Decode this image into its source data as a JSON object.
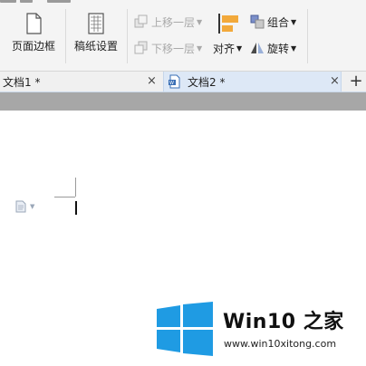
{
  "ribbon": {
    "page_border_label": "页面边框",
    "paper_settings_label": "稿纸设置",
    "bring_forward_label": "上移一层",
    "send_backward_label": "下移一层",
    "align_label": "对齐",
    "group_label": "组合",
    "rotate_label": "旋转"
  },
  "tabs": [
    {
      "label": "文档1 *",
      "close": "×"
    },
    {
      "label": "文档2 *",
      "close": "×"
    }
  ],
  "new_tab": "+",
  "watermark": {
    "title": "Win10 之家",
    "url": "www.win10xitong.com"
  },
  "colors": {
    "logo_blue": "#1f9be3",
    "tab_active": "#dde8f6",
    "ribbon_bg": "#f4f4f4",
    "gray_band": "#a7a7a7"
  }
}
